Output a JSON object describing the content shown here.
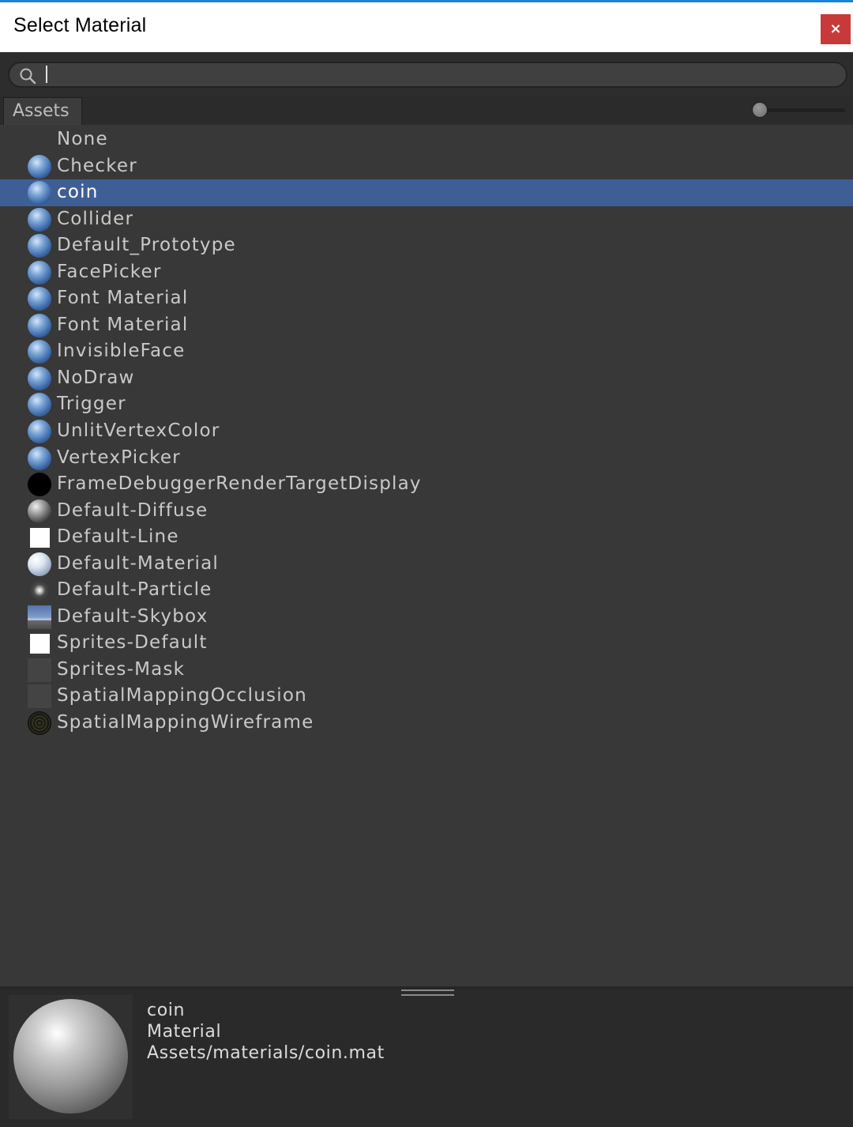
{
  "window": {
    "title": "Select Material",
    "close_label": "×"
  },
  "search": {
    "value": ""
  },
  "tabs": [
    {
      "label": "Assets"
    }
  ],
  "preview_size_slider": {
    "value": 0.0
  },
  "items": [
    {
      "label": "None",
      "icon": "none",
      "selected": false
    },
    {
      "label": "Checker",
      "icon": "blue-sphere-icon",
      "selected": false
    },
    {
      "label": "coin",
      "icon": "blue-sphere-icon",
      "selected": true
    },
    {
      "label": "Collider",
      "icon": "blue-sphere-icon",
      "selected": false
    },
    {
      "label": "Default_Prototype",
      "icon": "blue-sphere-icon",
      "selected": false
    },
    {
      "label": "FacePicker",
      "icon": "blue-sphere-icon",
      "selected": false
    },
    {
      "label": "Font Material",
      "icon": "blue-sphere-icon",
      "selected": false
    },
    {
      "label": "Font Material",
      "icon": "blue-sphere-icon",
      "selected": false
    },
    {
      "label": "InvisibleFace",
      "icon": "blue-sphere-icon",
      "selected": false
    },
    {
      "label": "NoDraw",
      "icon": "blue-sphere-icon",
      "selected": false
    },
    {
      "label": "Trigger",
      "icon": "blue-sphere-icon",
      "selected": false
    },
    {
      "label": "UnlitVertexColor",
      "icon": "blue-sphere-icon",
      "selected": false
    },
    {
      "label": "VertexPicker",
      "icon": "blue-sphere-icon",
      "selected": false
    },
    {
      "label": "FrameDebuggerRenderTargetDisplay",
      "icon": "black-sphere-icon",
      "selected": false
    },
    {
      "label": "Default-Diffuse",
      "icon": "gray-sphere-icon",
      "selected": false
    },
    {
      "label": "Default-Line",
      "icon": "white-square-icon",
      "selected": false
    },
    {
      "label": "Default-Material",
      "icon": "light-sphere-icon",
      "selected": false
    },
    {
      "label": "Default-Particle",
      "icon": "particle-icon",
      "selected": false
    },
    {
      "label": "Default-Skybox",
      "icon": "skybox-icon",
      "selected": false
    },
    {
      "label": "Sprites-Default",
      "icon": "white-square-icon",
      "selected": false
    },
    {
      "label": "Sprites-Mask",
      "icon": "dark-square-icon",
      "selected": false
    },
    {
      "label": "SpatialMappingOcclusion",
      "icon": "dark-square-icon",
      "selected": false
    },
    {
      "label": "SpatialMappingWireframe",
      "icon": "wireframe-sphere-icon",
      "selected": false
    }
  ],
  "preview": {
    "name": "coin",
    "type": "Material",
    "path": "Assets/materials/coin.mat"
  },
  "colors": {
    "selection": "#3e5f96",
    "background": "#383838",
    "close_button": "#c83a3a",
    "accent_line": "#1883d7"
  }
}
